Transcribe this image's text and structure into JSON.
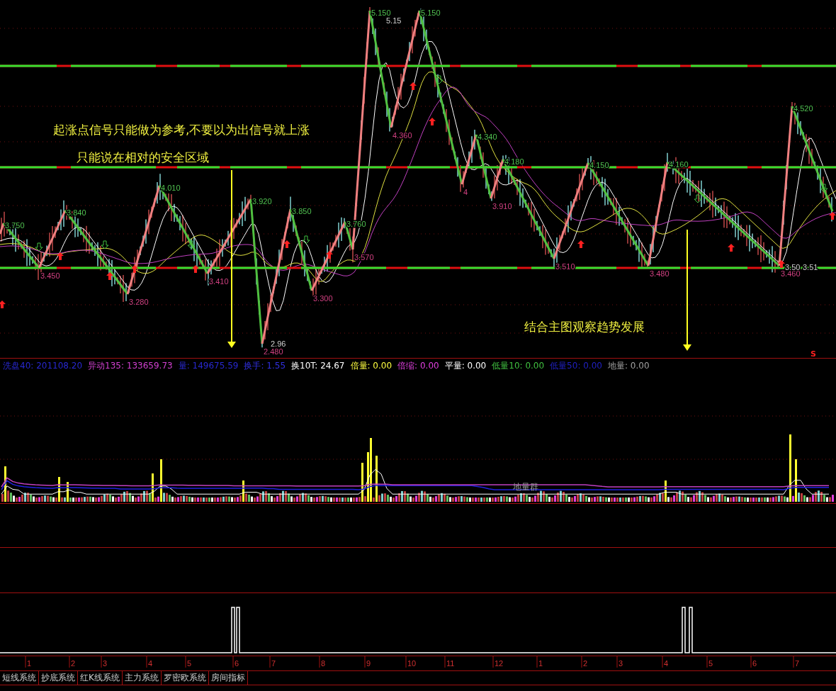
{
  "price_chart": {
    "annotations": [
      {
        "text": "起涨点信号只能做为参考,不要以为出信号就上涨"
      },
      {
        "text": "只能说在相对的安全区域"
      },
      {
        "text": "结合主图观察趋势发展"
      }
    ],
    "pivots": [
      {
        "label": "3.750",
        "kind": "peak"
      },
      {
        "label": "3.450",
        "kind": "trough"
      },
      {
        "label": "3.840",
        "kind": "peak"
      },
      {
        "label": "3.280",
        "kind": "trough"
      },
      {
        "label": "4.010",
        "kind": "peak"
      },
      {
        "label": "3.410",
        "kind": "trough"
      },
      {
        "label": "3.920",
        "kind": "peak"
      },
      {
        "label": "2.480",
        "kind": "trough"
      },
      {
        "label": "3.850",
        "kind": "peak"
      },
      {
        "label": "3.300",
        "kind": "trough"
      },
      {
        "label": "3.760",
        "kind": "peak"
      },
      {
        "label": "3.570",
        "kind": "trough"
      },
      {
        "label": "5.150",
        "kind": "peak"
      },
      {
        "label": "4.360",
        "kind": "trough"
      },
      {
        "label": "5.150",
        "kind": "peak"
      },
      {
        "label": "4",
        "kind": "trough"
      },
      {
        "label": "4.340",
        "kind": "peak"
      },
      {
        "label": "3.910",
        "kind": "trough"
      },
      {
        "label": "4.180",
        "kind": "peak"
      },
      {
        "label": "3.510",
        "kind": "trough"
      },
      {
        "label": "4.150",
        "kind": "peak"
      },
      {
        "label": "3.480",
        "kind": "trough"
      },
      {
        "label": "4.160",
        "kind": "peak"
      },
      {
        "label": "3.460",
        "kind": "trough"
      },
      {
        "label": "4.520",
        "kind": "peak"
      }
    ],
    "notes": [
      "5.15",
      "2.96",
      "3.50",
      "3.51"
    ],
    "signal_mark": "S"
  },
  "volume_panel": {
    "legend": [
      {
        "text": "洗盘40: 201108.20",
        "color": "#2828d0"
      },
      {
        "text": "异动135: 133659.73",
        "color": "#d040d0"
      },
      {
        "text": "量: 149675.59",
        "color": "#2828d0"
      },
      {
        "text": "换手: 1.55",
        "color": "#3030e0"
      },
      {
        "text": "换10T: 24.67",
        "color": "#ffffff"
      },
      {
        "text": "倍量: 0.00",
        "color": "#ffff40"
      },
      {
        "text": "倍缩: 0.00",
        "color": "#e040e0"
      },
      {
        "text": "平量: 0.00",
        "color": "#ffffff"
      },
      {
        "text": "低量10: 0.00",
        "color": "#40c040"
      },
      {
        "text": "低量50: 0.00",
        "color": "#2020c0"
      },
      {
        "text": "地量: 0.00",
        "color": "#a0a0a0"
      }
    ],
    "cluster_label": "地量群"
  },
  "time_axis": [
    "1",
    "2",
    "3",
    "4",
    "5",
    "6",
    "7",
    "8",
    "9",
    "10",
    "11",
    "12",
    "1",
    "2",
    "3",
    "4",
    "5",
    "6",
    "7"
  ],
  "tabs": [
    "短线系统",
    "抄底系统",
    "红K线系统",
    "主力系统",
    "罗密欧系统",
    "房间指标"
  ]
}
